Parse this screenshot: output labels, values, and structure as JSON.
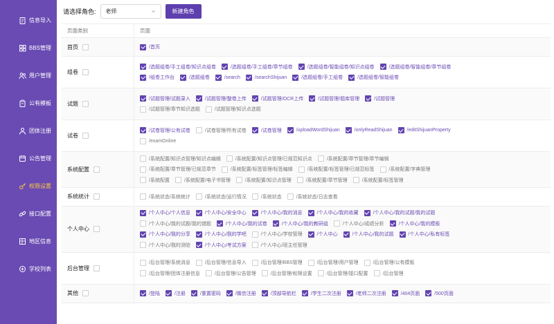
{
  "sidebar": {
    "items": [
      {
        "label": "信息导入",
        "icon": "document-import-icon",
        "active": false
      },
      {
        "label": "BBS管理",
        "icon": "grid-icon",
        "active": false
      },
      {
        "label": "用户管理",
        "icon": "users-icon",
        "active": false
      },
      {
        "label": "公有模板",
        "icon": "clipboard-icon",
        "active": false
      },
      {
        "label": "团体注册",
        "icon": "user-icon",
        "active": false
      },
      {
        "label": "公告管理",
        "icon": "announcement-icon",
        "active": false
      },
      {
        "label": "权限设置",
        "icon": "key-icon",
        "active": true
      },
      {
        "label": "接口配置",
        "icon": "link-icon",
        "active": false
      },
      {
        "label": "地区信息",
        "icon": "map-icon",
        "active": false
      },
      {
        "label": "学校列表",
        "icon": "school-icon",
        "active": false
      }
    ],
    "active_color": "#ffc940",
    "bg_color": "#6a4bb3"
  },
  "toolbar": {
    "role_label": "请选择角色:",
    "role_value": "老师",
    "new_role_label": "新建角色"
  },
  "table": {
    "headers": {
      "category": "页面类别",
      "page": "页面"
    },
    "rows": [
      {
        "category": "首页",
        "lines": [
          [
            {
              "t": "/首页",
              "on": true
            }
          ]
        ]
      },
      {
        "category": "组卷",
        "lines": [
          [
            {
              "t": "/选题组卷/手工组卷/知识点组卷",
              "on": true
            },
            {
              "t": "/选题组卷/手工组卷/章节组卷",
              "on": true
            },
            {
              "t": "/选题组卷/智能组卷/知识点组卷",
              "on": true
            },
            {
              "t": "/选题组卷/智能组卷/章节组卷",
              "on": true
            }
          ],
          [
            {
              "t": "/组卷工作台",
              "on": true
            },
            {
              "t": "/选题组卷",
              "on": true
            },
            {
              "t": "/search",
              "on": true
            },
            {
              "t": "/searchShijuan",
              "on": true
            },
            {
              "t": "/选题组卷/手工组卷",
              "on": true
            },
            {
              "t": "/选题组卷/智能组卷",
              "on": true
            }
          ]
        ]
      },
      {
        "category": "试题",
        "lines": [
          [
            {
              "t": "/试题管理/试题录入",
              "on": true
            },
            {
              "t": "/试题管理/整卷上传",
              "on": true
            },
            {
              "t": "/试题管理/OCR上传",
              "on": true
            },
            {
              "t": "/试题管理/题库管理",
              "on": true
            },
            {
              "t": "/试题管理",
              "on": true
            }
          ],
          [
            {
              "t": "/试题管理/章节知识选题",
              "on": false
            },
            {
              "t": "/试题管理/知识点选题",
              "on": false
            }
          ]
        ]
      },
      {
        "category": "试卷",
        "lines": [
          [
            {
              "t": "/试卷管理/公有试卷",
              "on": true
            },
            {
              "t": "/试卷管理/所有试卷",
              "on": false
            },
            {
              "t": "/试卷管理",
              "on": true
            },
            {
              "t": "/uploadWordShijuan",
              "on": true
            },
            {
              "t": "/onlyReadShijuan",
              "on": true
            },
            {
              "t": "/editShijuanProperty",
              "on": true
            }
          ],
          [
            {
              "t": "/examOnline",
              "on": false
            }
          ]
        ]
      },
      {
        "category": "系统配置",
        "lines": [
          [
            {
              "t": "/系统配置/知识点管理/知识点编辑",
              "on": false
            },
            {
              "t": "/系统配置/知识点管理/已规范知识点",
              "on": false
            },
            {
              "t": "/系统配置/章节管理/章节编辑",
              "on": false
            }
          ],
          [
            {
              "t": "/系统配置/章节管理/已规范章节",
              "on": false
            },
            {
              "t": "/系统配置/标签管理/标签编辑",
              "on": false
            },
            {
              "t": "/系统配置/标签管理/已规范标签",
              "on": false
            },
            {
              "t": "/系统配置/字典管理",
              "on": false
            }
          ],
          [
            {
              "t": "/系统配置",
              "on": false
            },
            {
              "t": "/系统配置/电子书管理",
              "on": false
            },
            {
              "t": "/系统配置/知识点管理",
              "on": false
            },
            {
              "t": "/系统配置/章节管理",
              "on": false
            },
            {
              "t": "/系统配置/标签管理",
              "on": false
            }
          ]
        ]
      },
      {
        "category": "系统统计",
        "lines": [
          [
            {
              "t": "/系统状态/系统统计",
              "on": false
            },
            {
              "t": "/系统状态/运行情况",
              "on": false
            },
            {
              "t": "/系统状态",
              "on": false
            },
            {
              "t": "/系统状态/日志查看",
              "on": false
            }
          ]
        ]
      },
      {
        "category": "个人中心",
        "lines": [
          [
            {
              "t": "/个人中心/个人信息",
              "on": true
            },
            {
              "t": "/个人中心/安全中心",
              "on": true
            },
            {
              "t": "/个人中心/我的消息",
              "on": true
            },
            {
              "t": "/个人中心/我的收藏",
              "on": true
            },
            {
              "t": "/个人中心/我的试题/我的试题",
              "on": true
            }
          ],
          [
            {
              "t": "/个人中心/我的试题/我的错题",
              "on": false
            },
            {
              "t": "/个人中心/我的试卷",
              "on": true
            },
            {
              "t": "/个人中心/我的教研组",
              "on": true
            },
            {
              "t": "/个人中心/成绩分析",
              "on": false
            },
            {
              "t": "/个人中心/我的模板",
              "on": true
            }
          ],
          [
            {
              "t": "/个人中心/我的分享",
              "on": true
            },
            {
              "t": "/个人中心/我的学吧",
              "on": true
            },
            {
              "t": "/个人中心/学校管理",
              "on": false
            },
            {
              "t": "/个人中心",
              "on": true
            },
            {
              "t": "/个人中心/我的试题",
              "on": true
            },
            {
              "t": "/个人中心/私有标签",
              "on": true
            }
          ],
          [
            {
              "t": "/个人中心/我的测验",
              "on": false
            },
            {
              "t": "/个人中心/考试方案",
              "on": true
            },
            {
              "t": "/个人中心/班主任管理",
              "on": false
            }
          ]
        ]
      },
      {
        "category": "后台管理",
        "lines": [
          [
            {
              "t": "/后台管理/系统消息",
              "on": false
            },
            {
              "t": "/后台管理/信息导入",
              "on": false
            },
            {
              "t": "/后台管理/BBS管理",
              "on": false
            },
            {
              "t": "/后台管理/用户管理",
              "on": false
            },
            {
              "t": "/后台管理/公有模板",
              "on": false
            }
          ],
          [
            {
              "t": "/后台管理/团体注册信息",
              "on": false
            },
            {
              "t": "/后台管理/公告管理",
              "on": false
            },
            {
              "t": "/后台管理/权限设置",
              "on": false
            },
            {
              "t": "/后台管理/接口配置",
              "on": false
            },
            {
              "t": "/后台管理",
              "on": false
            }
          ]
        ]
      },
      {
        "category": "其他",
        "lines": [
          [
            {
              "t": "/登陆",
              "on": true
            },
            {
              "t": "/注册",
              "on": true
            },
            {
              "t": "/重置密码",
              "on": true
            },
            {
              "t": "/微信注册",
              "on": true
            },
            {
              "t": "/顶部导航栏",
              "on": true
            },
            {
              "t": "/学生二次注册",
              "on": true
            },
            {
              "t": "/老师二次注册",
              "on": true
            },
            {
              "t": "/404页面",
              "on": true
            },
            {
              "t": "/500页面",
              "on": true
            }
          ]
        ]
      }
    ]
  }
}
